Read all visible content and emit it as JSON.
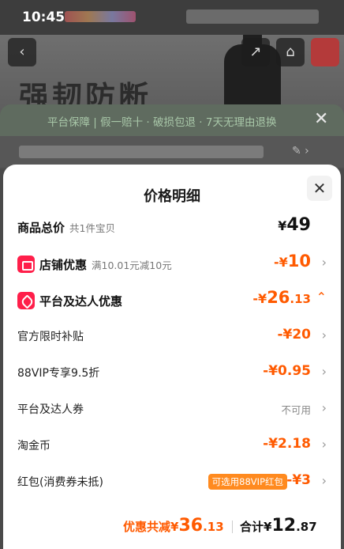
{
  "status_bar": {
    "time": "10:45"
  },
  "background": {
    "slogan": "强韧防断",
    "guarantee": "平台保障 | 假一赔十 · 破损包退 · 7天无理由退换"
  },
  "sheet": {
    "title": "价格明细",
    "rows": [
      {
        "label": "商品总价",
        "sub": "共1件宝贝",
        "amount_prefix": "¥",
        "amount": "49"
      },
      {
        "label": "店铺优惠",
        "sub": "满10.01元减10元",
        "amount_prefix": "-¥",
        "amount": "10"
      },
      {
        "label": "平台及达人优惠",
        "amount_prefix": "-¥",
        "amount": "26",
        "amount_dec": ".13"
      },
      {
        "label": "官方限时补贴",
        "amount": "-¥20"
      },
      {
        "label": "88VIP专享9.5折",
        "amount": "-¥0.95"
      },
      {
        "label": "平台及达人券",
        "amount": "不可用"
      },
      {
        "label": "淘金币",
        "amount": "-¥2.18"
      },
      {
        "label": "红包(消费券未抵)",
        "tag": "可选用88VIP红包",
        "amount": "-¥3"
      }
    ],
    "summary": {
      "save_label": "优惠共减¥",
      "save_int": "36",
      "save_dec": ".13",
      "total_label": "合计¥",
      "total_int": "12",
      "total_dec": ".87"
    }
  },
  "colors": {
    "accent": "#ff5a00",
    "badge": "#ff1f4a",
    "tag": "#ff8a1f"
  }
}
